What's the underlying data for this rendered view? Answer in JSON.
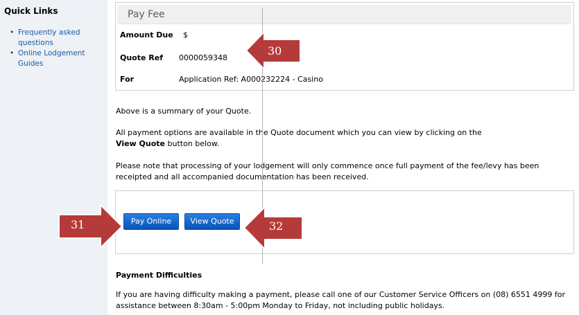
{
  "sidebar": {
    "title": "Quick Links",
    "links": [
      {
        "label": "Frequently asked questions"
      },
      {
        "label": "Online Lodgement Guides"
      }
    ]
  },
  "fee_panel": {
    "title": "Pay Fee",
    "rows": {
      "amount": {
        "label": "Amount Due",
        "value": "$"
      },
      "quote": {
        "label": "Quote Ref",
        "value": "0000059348"
      },
      "for": {
        "label": "For",
        "value": "Application Ref: A000232224 - Casino"
      }
    }
  },
  "body": {
    "summary": "Above is a summary of your Quote.",
    "options_line1": "All payment options are available in the Quote document which you can view by clicking on the",
    "options_bold": "View Quote",
    "options_line2": " button below.",
    "note": "Please note that processing of your lodgement will only commence once full payment of the fee/levy has been receipted and all accompanied documentation has been received."
  },
  "buttons": {
    "pay_online": "Pay Online",
    "view_quote": "View Quote"
  },
  "difficulties": {
    "title": "Payment Difficulties",
    "text": "If you are having difficulty making a payment, please call one of our Customer Service Officers on (08) 6551 4999 for assistance between 8:30am - 5:00pm Monday to Friday, not including public holidays."
  },
  "callouts": [
    {
      "number": "30",
      "color": "#b73a3a"
    },
    {
      "number": "31",
      "color": "#b73a3a"
    },
    {
      "number": "32",
      "color": "#b73a3a"
    }
  ]
}
